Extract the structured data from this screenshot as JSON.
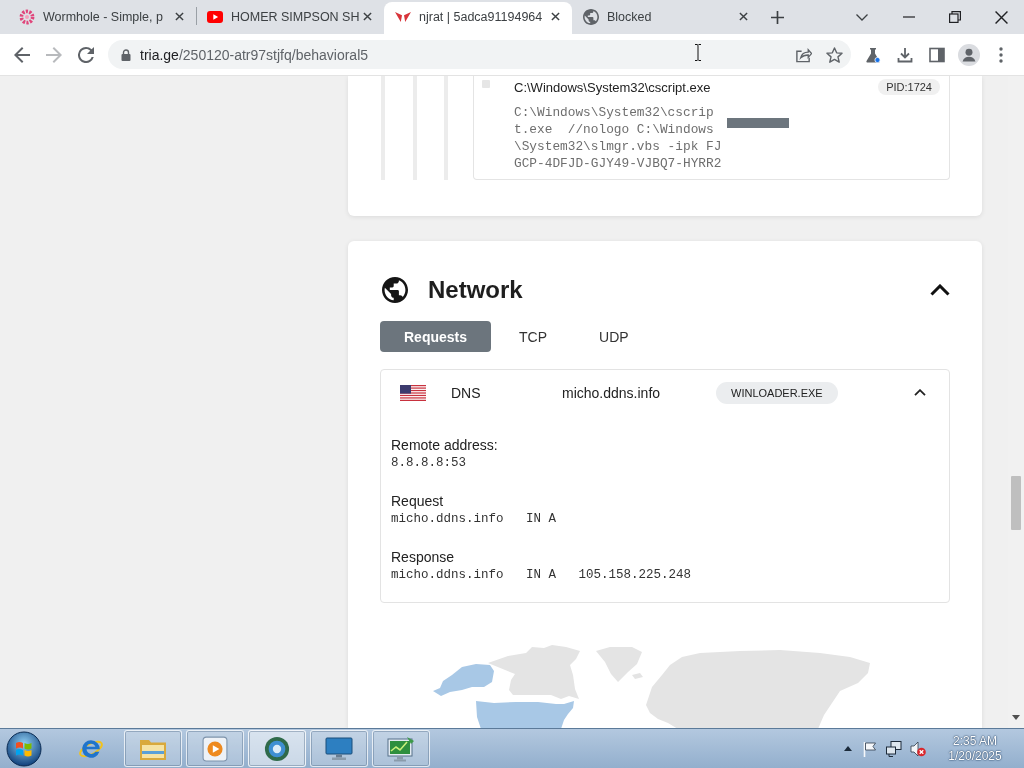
{
  "browser": {
    "tabs": [
      {
        "kind": "flower",
        "title": "Wormhole - Simple, p",
        "selected": false
      },
      {
        "kind": "play",
        "title": "HOMER SIMPSON SH",
        "selected": false
      },
      {
        "kind": "wings",
        "title": "njrat | 5adca91194964",
        "selected": true
      },
      {
        "kind": "globe",
        "title": "Blocked",
        "selected": false
      }
    ],
    "toolbar": {
      "forward_disabled": true
    },
    "address": {
      "host": "tria.ge",
      "path": "/250120-atr97stjfq/behavioral5"
    }
  },
  "process": {
    "path": "C:\\Windows\\System32\\cscript.exe",
    "pid": "PID:1724",
    "command_lines": [
      "C:\\Windows\\System32\\cscrip",
      "t.exe  //nologo C:\\Windows",
      "\\System32\\slmgr.vbs -ipk FJ",
      "GCP-4DFJD-GJY49-VJBQ7-HYRR2"
    ]
  },
  "network": {
    "title": "Network",
    "expanded": true,
    "tabs": [
      {
        "label": "Requests",
        "selected": true
      },
      {
        "label": "TCP",
        "selected": false
      },
      {
        "label": "UDP",
        "selected": false
      }
    ],
    "requests": [
      {
        "protocol": "DNS",
        "domain": "micho.ddns.info",
        "process": "WINLOADER.EXE",
        "expanded": true,
        "details": [
          {
            "label": "Remote address:",
            "value": "8.8.8.8:53"
          },
          {
            "label": "Request",
            "value": "micho.ddns.info   IN A"
          },
          {
            "label": "Response",
            "value": "micho.ddns.info   IN A   105.158.225.248"
          }
        ]
      }
    ]
  },
  "taskbar": {
    "buttons": [
      {
        "kind": "browser",
        "running": false,
        "selected": false
      },
      {
        "kind": "folder",
        "running": true,
        "selected": false
      },
      {
        "kind": "player",
        "running": true,
        "selected": false
      },
      {
        "kind": "ring",
        "running": true,
        "selected": true
      },
      {
        "kind": "monitor",
        "running": true,
        "selected": false
      },
      {
        "kind": "chart",
        "running": true,
        "selected": false
      }
    ],
    "clock": {
      "time": "2:35 AM",
      "date": "1/20/2025"
    }
  }
}
